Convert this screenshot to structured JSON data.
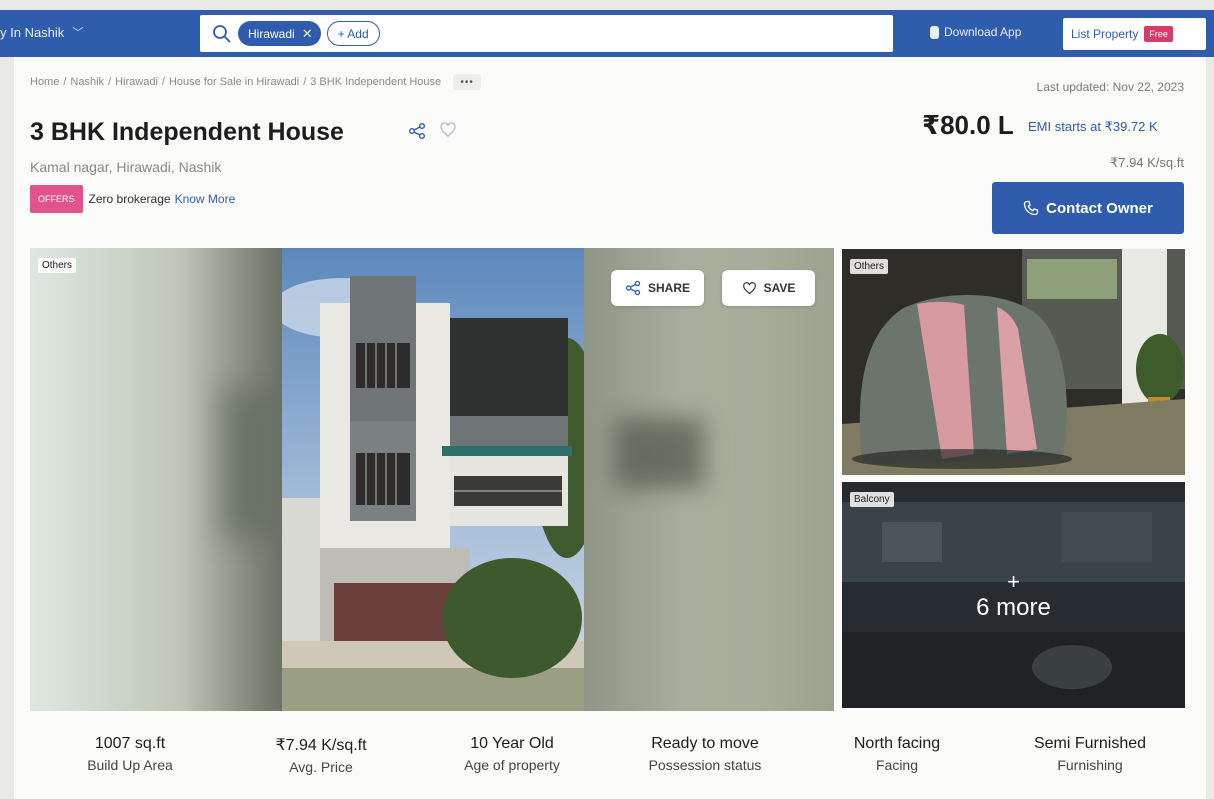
{
  "header": {
    "city": "y In Nashik",
    "search_chip": "Hirawadi",
    "add_label": "+ Add",
    "download_app": "Download App",
    "list_property": "List Property",
    "free_badge": "Free"
  },
  "breadcrumb": {
    "items": [
      "Home",
      "Nashik",
      "Hirawadi",
      "House for Sale in Hirawadi",
      "3 BHK Independent House"
    ],
    "more": "•••"
  },
  "last_updated": "Last updated: Nov 22, 2023",
  "listing": {
    "title": "3 BHK Independent House",
    "location": "Kamal nagar, Hirawadi, Nashik",
    "offer_badge": "OFFERS",
    "offer_text": "Zero brokerage",
    "know_more": "Know More",
    "price": "₹80.0 L",
    "emi": "EMI starts at ₹39.72 K",
    "price_per_sqft": "₹7.94 K/sq.ft",
    "contact_label": "Contact Owner"
  },
  "gallery": {
    "main_tag": "Others",
    "share_label": "SHARE",
    "save_label": "SAVE",
    "thumb1_tag": "Others",
    "thumb2_tag": "Balcony",
    "more_plus": "+",
    "more_label": "6 more"
  },
  "stats": [
    {
      "value": "1007 sq.ft",
      "label": "Build Up Area"
    },
    {
      "value": "₹7.94 K/sq.ft",
      "label": "Avg. Price"
    },
    {
      "value": "10 Year Old",
      "label": "Age of property"
    },
    {
      "value": "Ready to move",
      "label": "Possession status"
    },
    {
      "value": "North facing",
      "label": "Facing"
    },
    {
      "value": "Semi Furnished",
      "label": "Furnishing"
    }
  ],
  "icons": {
    "search": "search-icon",
    "close": "close-icon",
    "chevron": "chevron-down-icon",
    "phone": "phone-icon",
    "share": "share-icon",
    "heart": "heart-icon"
  },
  "colors": {
    "brand_blue": "#2f5cad",
    "offer_pink": "#e0548a",
    "free_badge": "#d83a6c"
  }
}
